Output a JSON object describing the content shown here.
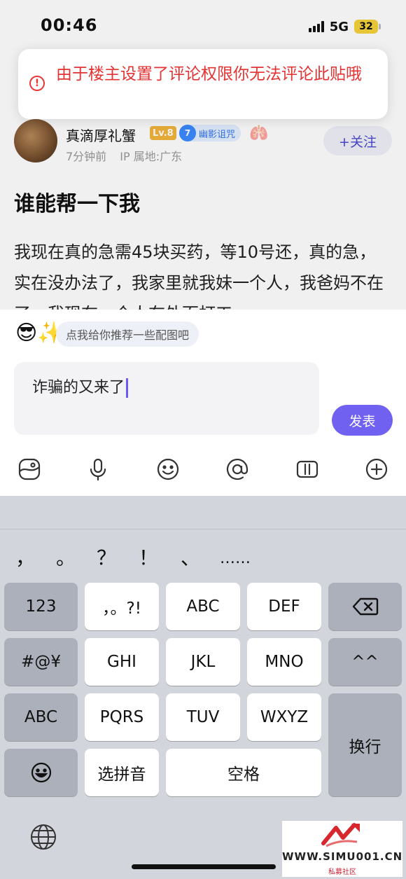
{
  "status_bar": {
    "time": "00:46",
    "network": "5G",
    "battery": "32"
  },
  "toast": {
    "icon": "error-circle-icon",
    "message": "由于楼主设置了评论权限你无法评论此贴哦"
  },
  "post": {
    "author": {
      "name": "真滴厚礼蟹",
      "level": "Lv.8",
      "fan_badge_level": "7",
      "fan_badge_name": "幽影诅咒",
      "extra_emoji": "🫁",
      "time": "7分钟前",
      "ip": "IP 属地:广东"
    },
    "follow_label": "+关注",
    "title": "谁能帮一下我",
    "body": "我现在真的急需45块买药，等10号还，真的急，实在没办法了，我家里就我妹一个人，我爸妈不在了，我现在一个人在外面打工"
  },
  "composer": {
    "suggestion_emoji": "😎✨",
    "suggestion_text": "点我给你推荐一些配图吧",
    "input_value": "诈骗的又来了",
    "send_label": "发表",
    "tools": [
      "sticker-icon",
      "microphone-icon",
      "emoji-icon",
      "at-mention-icon",
      "topic-icon",
      "plus-icon"
    ]
  },
  "keyboard": {
    "punctuation": [
      "，",
      "。",
      "？",
      "！",
      "、",
      "……"
    ],
    "keys": {
      "num": "123",
      "sym": "，。?!",
      "abc2": "ABC",
      "def": "DEF",
      "sym2": "#@¥",
      "ghi": "GHI",
      "jkl": "JKL",
      "mno": "MNO",
      "face": "^^",
      "abc": "ABC",
      "pqrs": "PQRS",
      "tuv": "TUV",
      "wxyz": "WXYZ",
      "enter": "换行",
      "pinyin": "选拼音",
      "space": "空格"
    }
  },
  "watermark": {
    "site": "WWW.SIMU001.CN",
    "sub": "私募社区"
  },
  "colors": {
    "accent": "#7061f0",
    "error": "#e33333",
    "battery": "#f5d33a"
  }
}
